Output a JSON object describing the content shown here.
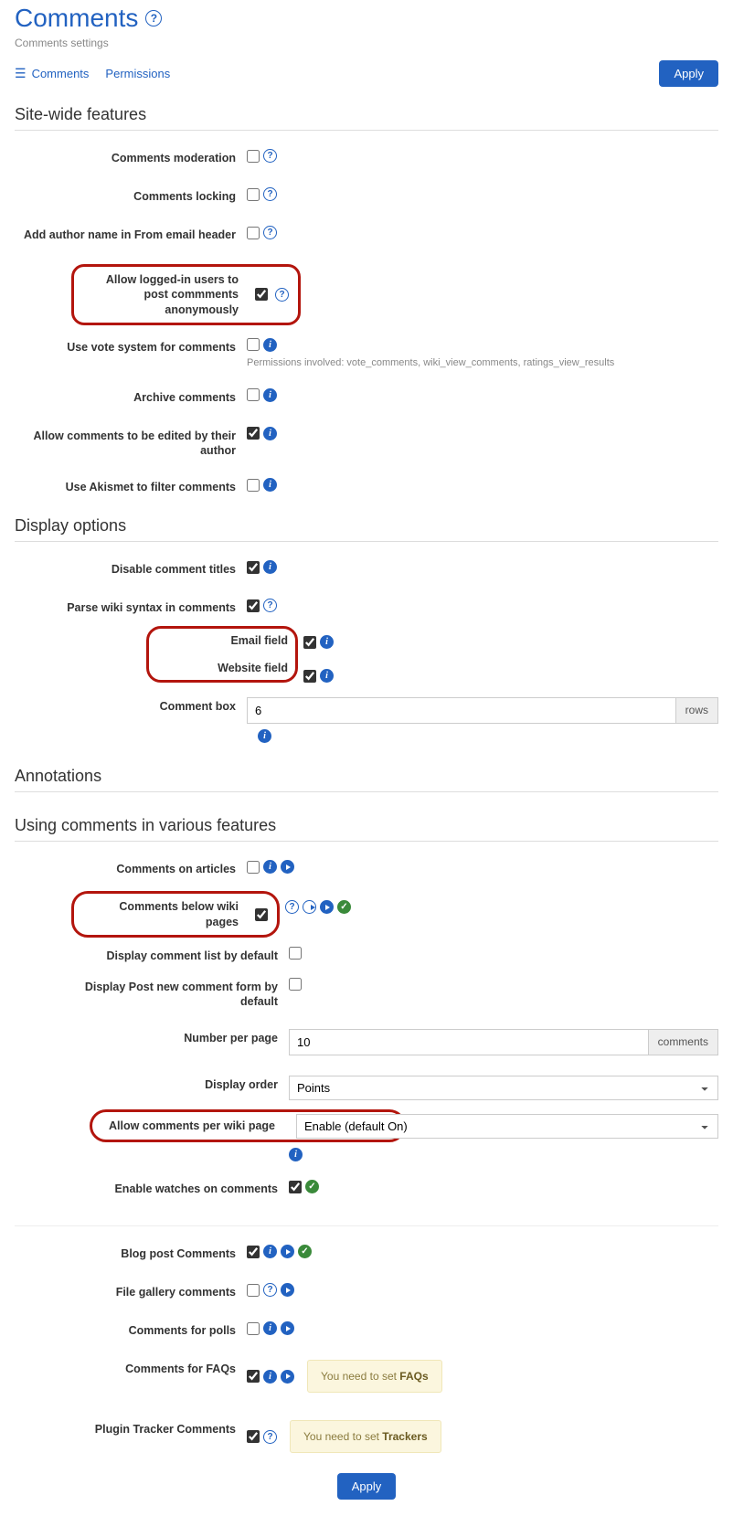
{
  "header": {
    "title": "Comments",
    "subtitle": "Comments settings"
  },
  "tabs": {
    "comments": "Comments",
    "permissions": "Permissions"
  },
  "buttons": {
    "apply": "Apply"
  },
  "sections": {
    "siteWide": "Site-wide features",
    "display": "Display options",
    "annotations": "Annotations",
    "various": "Using comments in various features"
  },
  "siteWide": {
    "moderation": "Comments moderation",
    "locking": "Comments locking",
    "fromHeader": "Add author name in From email header",
    "anonPost": "Allow logged-in users to post commments anonymously",
    "voteSystem": "Use vote system for comments",
    "voteHint": "Permissions involved: vote_comments, wiki_view_comments, ratings_view_results",
    "archive": "Archive comments",
    "editByAuthor": "Allow comments to be edited by their author",
    "akismet": "Use Akismet to filter comments"
  },
  "display": {
    "disableTitles": "Disable comment titles",
    "parseWiki": "Parse wiki syntax in comments",
    "emailField": "Email field",
    "websiteField": "Website field",
    "commentBox": "Comment box",
    "commentBoxValue": "6",
    "rows": "rows"
  },
  "various": {
    "onArticles": "Comments on articles",
    "belowWiki": "Comments below wiki pages",
    "displayList": "Display comment list by default",
    "displayPostForm": "Display Post new comment form by default",
    "numPerPage": "Number per page",
    "numPerPageValue": "10",
    "commentsSuffix": "comments",
    "displayOrder": "Display order",
    "displayOrderValue": "Points",
    "allowPerWiki": "Allow comments per wiki page",
    "allowPerWikiValue": "Enable (default On)",
    "enableWatches": "Enable watches on comments",
    "blogPost": "Blog post Comments",
    "fileGallery": "File gallery comments",
    "polls": "Comments for polls",
    "faqs": "Comments for FAQs",
    "faqsNoticePre": "You need to set ",
    "faqsNoticeStrong": "FAQs",
    "tracker": "Plugin Tracker Comments",
    "trackerNoticePre": "You need to set ",
    "trackerNoticeStrong": "Trackers"
  }
}
